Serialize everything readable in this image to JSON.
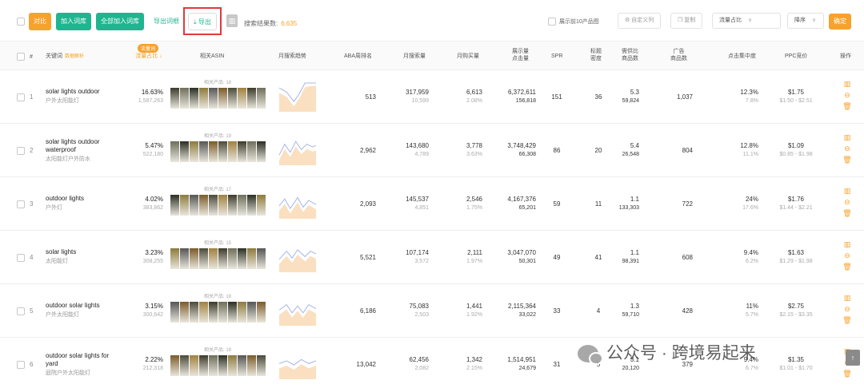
{
  "toolbar": {
    "compare_label": "对比",
    "add_root_label": "加入词库",
    "add_all_label": "全部加入词库",
    "export_root_label": "导出词根",
    "export_label": "导出",
    "count_label": "搜索结果数:",
    "count_value": "6,635",
    "top10_label": "展示前10产品图",
    "custom_cols_label": "自定义列",
    "copy_label": "复制",
    "sort_field_value": "流量占比",
    "sort_order_value": "降序",
    "confirm_label": "确定"
  },
  "headers": {
    "index": "#",
    "keyword": "关键词",
    "keyword_link": "数据解析",
    "traffic_badge": "流量词",
    "traffic_share": "流量占比",
    "related_asin": "相关ASIN",
    "monthly_trend": "月搜索趋势",
    "aba_rank": "ABA周排名",
    "monthly_search": "月搜索量",
    "monthly_purchase": "月购买量",
    "impressions_1": "展示量",
    "impressions_2": "点击量",
    "spr": "SPR",
    "title_density_1": "标题",
    "title_density_2": "密度",
    "supply_demand_1": "需供比",
    "supply_demand_2": "商品数",
    "ad_products_1": "广告",
    "ad_products_2": "商品数",
    "click_concentration": "点击集中度",
    "ppc_bid": "PPC竞价",
    "actions": "操作"
  },
  "rows": [
    {
      "index": "1",
      "kw": "solar lights outdoor",
      "kw2": "",
      "cn": "户外太阳能灯",
      "share": "16.63%",
      "share_sub": "1,587,263",
      "asin_label": "相关产品: 18",
      "aba": "513",
      "ms": "317,959",
      "ms_sub": "10,599",
      "mp": "6,613",
      "mp_sub": "2.08%",
      "imp": "6,372,611",
      "clk": "156,818",
      "spr": "151",
      "td": "36",
      "sd": "5.3",
      "sd_sub": "59,824",
      "ad": "1,037",
      "cc": "12.3%",
      "cc_sub": "7.8%",
      "ppc": "$1.75",
      "ppc_sub": "$1.50 - $2.51",
      "spark": [
        [
          0,
          0.7
        ],
        [
          0.2,
          0.55
        ],
        [
          0.4,
          0.2
        ],
        [
          0.55,
          0.5
        ],
        [
          0.7,
          0.9
        ],
        [
          0.85,
          0.95
        ],
        [
          1,
          0.95
        ]
      ]
    },
    {
      "index": "2",
      "kw": "solar lights outdoor",
      "kw2": "waterproof",
      "cn": "太阳能灯户外防水",
      "share": "5.47%",
      "share_sub": "522,180",
      "asin_label": "相关产品: 19",
      "aba": "2,962",
      "ms": "143,680",
      "ms_sub": "4,789",
      "mp": "3,778",
      "mp_sub": "3.63%",
      "imp": "3,748,429",
      "clk": "66,308",
      "spr": "86",
      "td": "20",
      "sd": "5.4",
      "sd_sub": "26,548",
      "ad": "804",
      "cc": "12.8%",
      "cc_sub": "11.1%",
      "ppc": "$1.09",
      "ppc_sub": "$0.85 - $1.98",
      "spark": [
        [
          0,
          0.2
        ],
        [
          0.15,
          0.6
        ],
        [
          0.3,
          0.3
        ],
        [
          0.45,
          0.7
        ],
        [
          0.6,
          0.4
        ],
        [
          0.75,
          0.6
        ],
        [
          0.9,
          0.5
        ],
        [
          1,
          0.55
        ]
      ]
    },
    {
      "index": "3",
      "kw": "outdoor lights",
      "kw2": "",
      "cn": "户外灯",
      "share": "4.02%",
      "share_sub": "383,862",
      "asin_label": "相关产品: 17",
      "aba": "2,093",
      "ms": "145,537",
      "ms_sub": "4,851",
      "mp": "2,546",
      "mp_sub": "1.75%",
      "imp": "4,167,376",
      "clk": "65,201",
      "spr": "59",
      "td": "11",
      "sd": "1.1",
      "sd_sub": "133,303",
      "ad": "722",
      "cc": "24%",
      "cc_sub": "17.6%",
      "ppc": "$1.76",
      "ppc_sub": "$1.44 - $2.21",
      "spark": [
        [
          0,
          0.3
        ],
        [
          0.15,
          0.55
        ],
        [
          0.3,
          0.2
        ],
        [
          0.5,
          0.6
        ],
        [
          0.65,
          0.25
        ],
        [
          0.8,
          0.5
        ],
        [
          1,
          0.35
        ]
      ]
    },
    {
      "index": "4",
      "kw": "solar lights",
      "kw2": "",
      "cn": "太阳能灯",
      "share": "3.23%",
      "share_sub": "308,255",
      "asin_label": "相关产品: 15",
      "aba": "5,521",
      "ms": "107,174",
      "ms_sub": "3,572",
      "mp": "2,111",
      "mp_sub": "1.97%",
      "imp": "3,047,070",
      "clk": "50,301",
      "spr": "49",
      "td": "41",
      "sd": "1.1",
      "sd_sub": "98,391",
      "ad": "608",
      "cc": "9.4%",
      "cc_sub": "6.2%",
      "ppc": "$1.63",
      "ppc_sub": "$1.29 - $1.98",
      "spark": [
        [
          0,
          0.3
        ],
        [
          0.2,
          0.6
        ],
        [
          0.35,
          0.35
        ],
        [
          0.5,
          0.65
        ],
        [
          0.7,
          0.4
        ],
        [
          0.85,
          0.6
        ],
        [
          1,
          0.5
        ]
      ]
    },
    {
      "index": "5",
      "kw": "outdoor solar lights",
      "kw2": "",
      "cn": "户外太阳能灯",
      "share": "3.15%",
      "share_sub": "300,642",
      "asin_label": "相关产品: 18",
      "aba": "6,186",
      "ms": "75,083",
      "ms_sub": "2,503",
      "mp": "1,441",
      "mp_sub": "1.92%",
      "imp": "2,115,364",
      "clk": "33,022",
      "spr": "33",
      "td": "4",
      "sd": "1.3",
      "sd_sub": "59,710",
      "ad": "428",
      "cc": "11%",
      "cc_sub": "5.7%",
      "ppc": "$2.75",
      "ppc_sub": "$2.15 - $3.35",
      "spark": [
        [
          0,
          0.4
        ],
        [
          0.2,
          0.6
        ],
        [
          0.35,
          0.3
        ],
        [
          0.5,
          0.55
        ],
        [
          0.65,
          0.3
        ],
        [
          0.8,
          0.6
        ],
        [
          1,
          0.45
        ]
      ]
    },
    {
      "index": "6",
      "kw": "outdoor solar lights for",
      "kw2": "yard",
      "cn": "庭院户外太阳能灯",
      "share": "2.22%",
      "share_sub": "212,318",
      "asin_label": "相关产品: 18",
      "aba": "13,042",
      "ms": "62,456",
      "ms_sub": "2,082",
      "mp": "1,342",
      "mp_sub": "2.15%",
      "imp": "1,514,951",
      "clk": "24,679",
      "spr": "31",
      "td": "5",
      "sd": "3.1",
      "sd_sub": "20,120",
      "ad": "379",
      "cc": "9.4%",
      "cc_sub": "6.7%",
      "ppc": "$1.35",
      "ppc_sub": "$1.01 - $1.70",
      "spark": [
        [
          0,
          0.4
        ],
        [
          0.2,
          0.5
        ],
        [
          0.4,
          0.35
        ],
        [
          0.6,
          0.55
        ],
        [
          0.8,
          0.4
        ],
        [
          1,
          0.5
        ]
      ]
    }
  ],
  "watermark": "公众号 · 跨境易起来",
  "colors": {
    "accent": "#f7a22c",
    "green": "#1fb58f",
    "export_frame": "#e0393e",
    "spark_a": "#f5c78c",
    "spark_b": "#a7b4e8"
  },
  "icons": [
    "bar-chart-icon",
    "minus-circle-icon",
    "trash-icon",
    "download-icon",
    "arrow-up-icon",
    "wechat-icon"
  ]
}
